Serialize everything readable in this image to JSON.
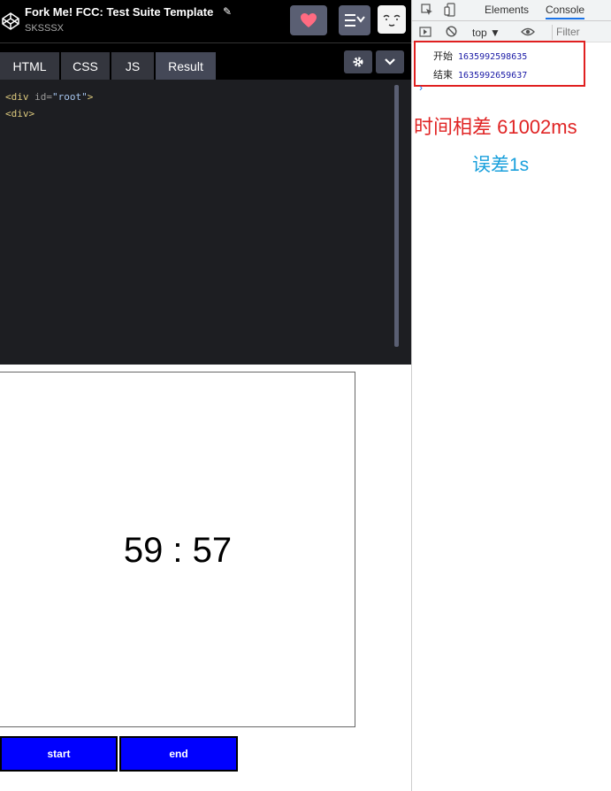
{
  "header": {
    "title": "Fork Me! FCC: Test Suite Template",
    "author": "SKSSSX"
  },
  "editor_tabs": [
    "HTML",
    "CSS",
    "JS",
    "Result"
  ],
  "code_lines": [
    {
      "tag_open": "<div ",
      "attr": "id=",
      "str": "\"root\"",
      "tag_close": ">"
    },
    {
      "tag_open": "<div>",
      "attr": "",
      "str": "",
      "tag_close": ""
    }
  ],
  "timer": {
    "display": "59 : 57"
  },
  "buttons": {
    "start": "start",
    "end": "end"
  },
  "devtools": {
    "tabs": [
      "Elements",
      "Console"
    ],
    "context": "top ▼",
    "filter_placeholder": "Filter",
    "logs": [
      {
        "label": "开始",
        "value": "1635992598635"
      },
      {
        "label": "结束",
        "value": "1635992659637"
      }
    ],
    "prompt": "›"
  },
  "annotations": {
    "diff": "时间相差 61002ms",
    "error": "误差1s"
  },
  "colors": {
    "accent_red": "#e02424",
    "accent_blue": "#1aa0dc",
    "button_blue": "#0000ff"
  }
}
